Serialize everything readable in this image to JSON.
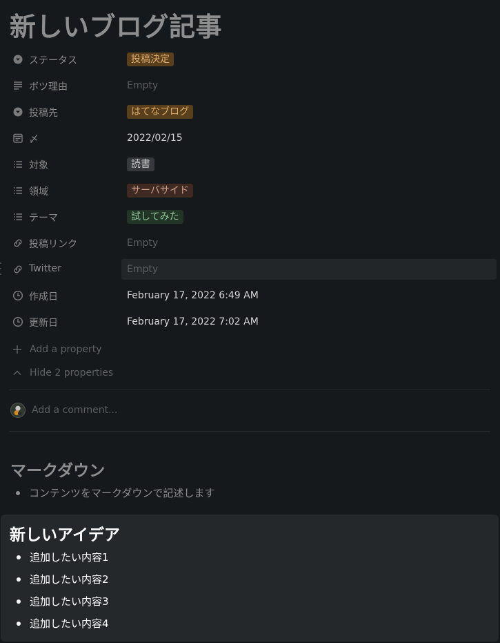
{
  "page": {
    "title": "新しいブログ記事"
  },
  "properties": [
    {
      "icon": "select-icon",
      "name": "ステータス",
      "value": "投稿決定",
      "kind": "tag",
      "tag_bg": "#5a3f1c",
      "tag_fg": "#d9a96a"
    },
    {
      "icon": "text-icon",
      "name": "ボツ理由",
      "value": "Empty",
      "kind": "empty"
    },
    {
      "icon": "select-icon",
      "name": "投稿先",
      "value": "はてなブログ",
      "kind": "tag",
      "tag_bg": "#5a3f1c",
      "tag_fg": "#d9a96a"
    },
    {
      "icon": "calendar-icon",
      "name": "〆",
      "value": "2022/02/15",
      "kind": "text"
    },
    {
      "icon": "list-icon",
      "name": "対象",
      "value": "読書",
      "kind": "tag",
      "tag_bg": "#35393b",
      "tag_fg": "#c8c8c8"
    },
    {
      "icon": "list-icon",
      "name": "領域",
      "value": "サーバサイド",
      "kind": "tag",
      "tag_bg": "#3e2a22",
      "tag_fg": "#cf9f8a"
    },
    {
      "icon": "list-icon",
      "name": "テーマ",
      "value": "試してみた",
      "kind": "tag",
      "tag_bg": "#233527",
      "tag_fg": "#8fc49a"
    },
    {
      "icon": "link-icon",
      "name": "投稿リンク",
      "value": "Empty",
      "kind": "empty"
    },
    {
      "icon": "link-icon",
      "name": "Twitter",
      "value": "Empty",
      "kind": "empty",
      "hover": true
    },
    {
      "icon": "clock-icon",
      "name": "作成日",
      "value": "February 17, 2022 6:49 AM",
      "kind": "text"
    },
    {
      "icon": "clock-icon",
      "name": "更新日",
      "value": "February 17, 2022 7:02 AM",
      "kind": "text"
    }
  ],
  "actions": {
    "add_property": "Add a property",
    "hide_properties": "Hide 2 properties"
  },
  "comment": {
    "placeholder": "Add a comment..."
  },
  "content": {
    "markdown_heading": "マークダウン",
    "markdown_items": [
      "コンテンツをマークダウンで記述します"
    ],
    "idea_heading": "新しいアイデア",
    "idea_items": [
      "追加したい内容1",
      "追加したい内容2",
      "追加したい内容3",
      "追加したい内容4"
    ]
  },
  "colors": {
    "background": "#16191b",
    "callout": "#24282a",
    "muted_text": "#8e8e8e",
    "bright_text": "#ffffff"
  }
}
